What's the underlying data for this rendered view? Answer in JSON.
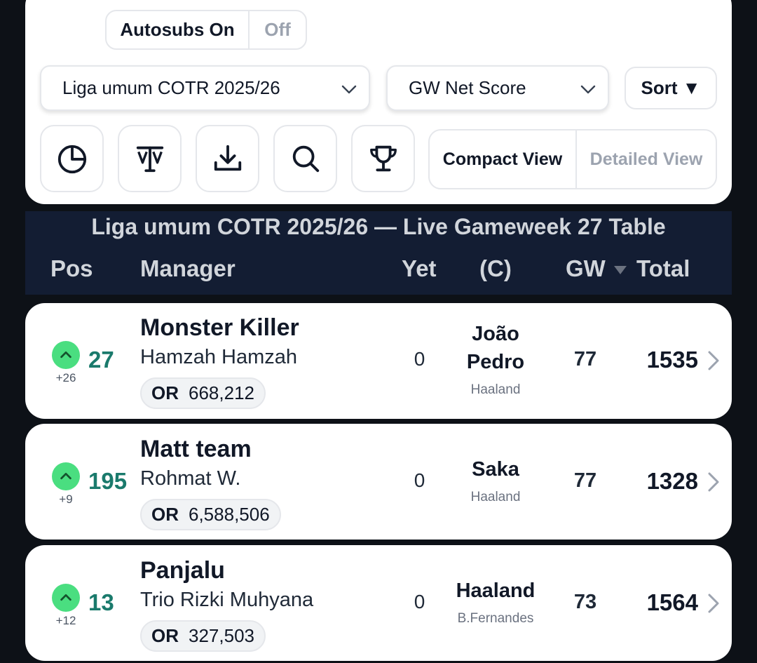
{
  "autosubs": {
    "on_label": "Autosubs On",
    "off_label": "Off"
  },
  "league_select": {
    "value": "Liga umum COTR 2025/26"
  },
  "metric_select": {
    "value": "GW Net Score"
  },
  "sort_button": {
    "label": "Sort ▼"
  },
  "toolbar": {
    "icons": [
      "pie-chart-icon",
      "transfers-icon",
      "download-icon",
      "search-icon",
      "trophy-icon"
    ]
  },
  "view_toggle": {
    "compact": "Compact View",
    "detailed": "Detailed View"
  },
  "table": {
    "title": "Liga umum COTR 2025/26 — Live Gameweek 27 Table",
    "columns": {
      "pos": "Pos",
      "manager": "Manager",
      "yet": "Yet",
      "captain": "(C)",
      "gw": "GW",
      "total": "Total"
    }
  },
  "rows": [
    {
      "delta": "+26",
      "rank": "27",
      "team": "Monster Killer",
      "manager": "Hamzah Hamzah",
      "or_label": "OR",
      "or_value": "668,212",
      "yet": "0",
      "captain": "João Pedro",
      "vice": "Haaland",
      "gw": "77",
      "total": "1535"
    },
    {
      "delta": "+9",
      "rank": "195",
      "team": "Matt team",
      "manager": "Rohmat W.",
      "or_label": "OR",
      "or_value": "6,588,506",
      "yet": "0",
      "captain": "Saka",
      "vice": "Haaland",
      "gw": "77",
      "total": "1328"
    },
    {
      "delta": "+12",
      "rank": "13",
      "team": "Panjalu",
      "manager": "Trio Rizki Muhyana",
      "or_label": "OR",
      "or_value": "327,503",
      "yet": "0",
      "captain": "Haaland",
      "vice": "B.Fernandes",
      "gw": "73",
      "total": "1564"
    }
  ],
  "colors": {
    "accent_rank": "#1a7a6c",
    "movement_up": "#4ade80",
    "header_bg": "#131d33",
    "page_bg": "#0d1117"
  }
}
